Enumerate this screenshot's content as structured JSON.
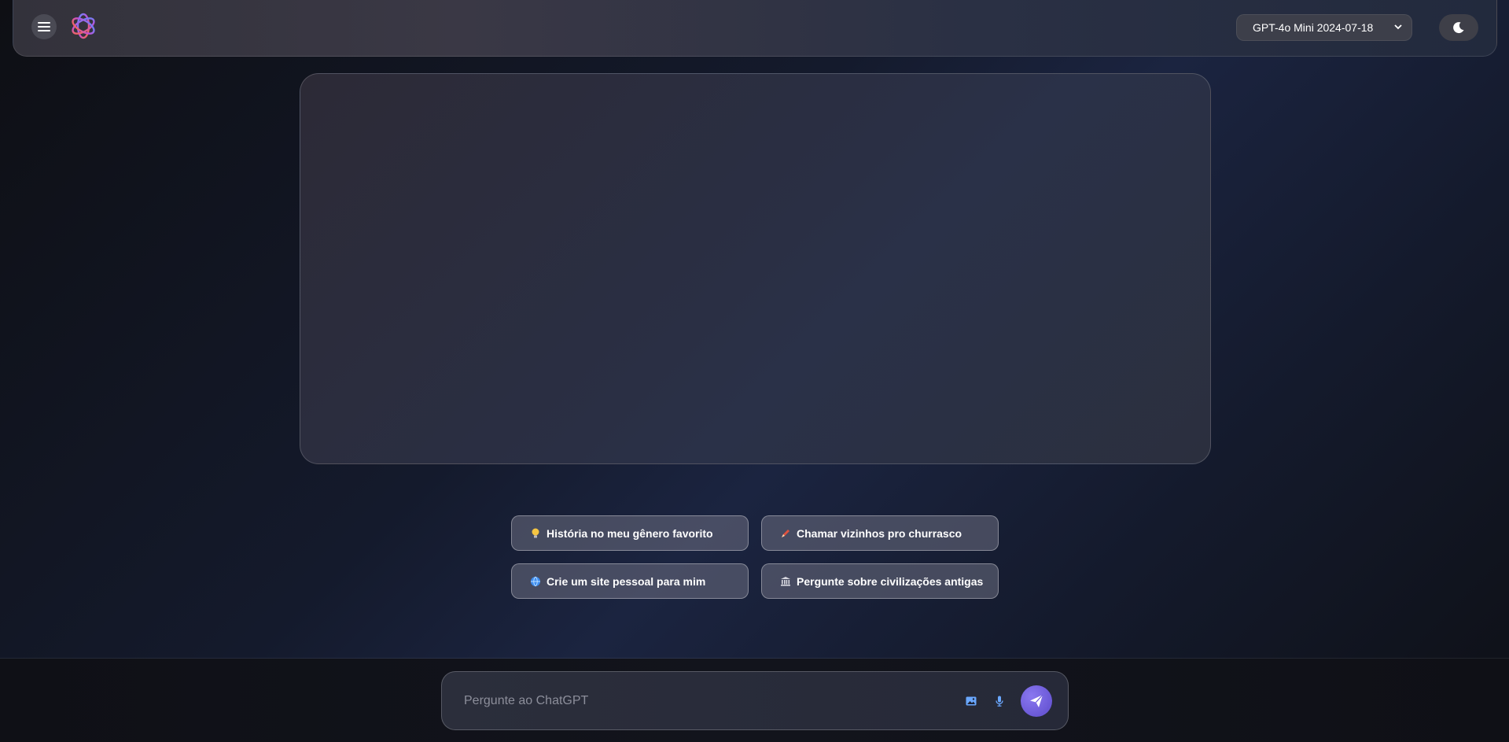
{
  "header": {
    "menu_icon": "hamburger-menu-icon",
    "logo_icon": "chatgpt-logo-icon",
    "model_select": {
      "selected": "GPT-4o Mini 2024-07-18",
      "icon": "chevron-down-icon"
    },
    "theme_toggle_icon": "moon-icon"
  },
  "suggestions": [
    {
      "icon": "lightbulb-icon",
      "label": "História no meu gênero favorito"
    },
    {
      "icon": "crayon-icon",
      "label": "Chamar vizinhos pro churrasco"
    },
    {
      "icon": "globe-icon",
      "label": "Crie um site pessoal para mim"
    },
    {
      "icon": "classical-building-icon",
      "label": "Pergunte sobre civilizações antigas"
    }
  ],
  "composer": {
    "placeholder": "Pergunte ao ChatGPT",
    "value": "",
    "image_icon": "image-icon",
    "mic_icon": "microphone-icon",
    "send_icon": "paper-plane-icon"
  },
  "colors": {
    "accent": "#7b68ee",
    "icon_blue": "#6aa8ff"
  }
}
